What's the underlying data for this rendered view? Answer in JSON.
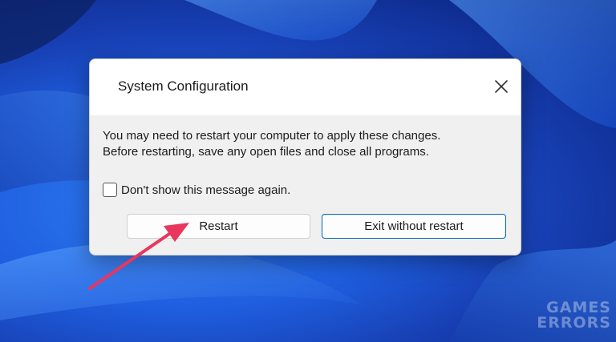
{
  "dialog": {
    "title": "System Configuration",
    "message_line1": "You may need to restart your computer to apply these changes.",
    "message_line2": "Before restarting, save any open files and close all programs.",
    "checkbox_label": "Don't show this message again.",
    "checkbox_checked": false,
    "restart_button": "Restart",
    "exit_button": "Exit without restart",
    "close_icon": "close-icon"
  },
  "watermark": {
    "line1": "GAMES",
    "line2": "ERRORS"
  },
  "colors": {
    "accent": "#0067c0",
    "arrow": "#e8365d"
  }
}
